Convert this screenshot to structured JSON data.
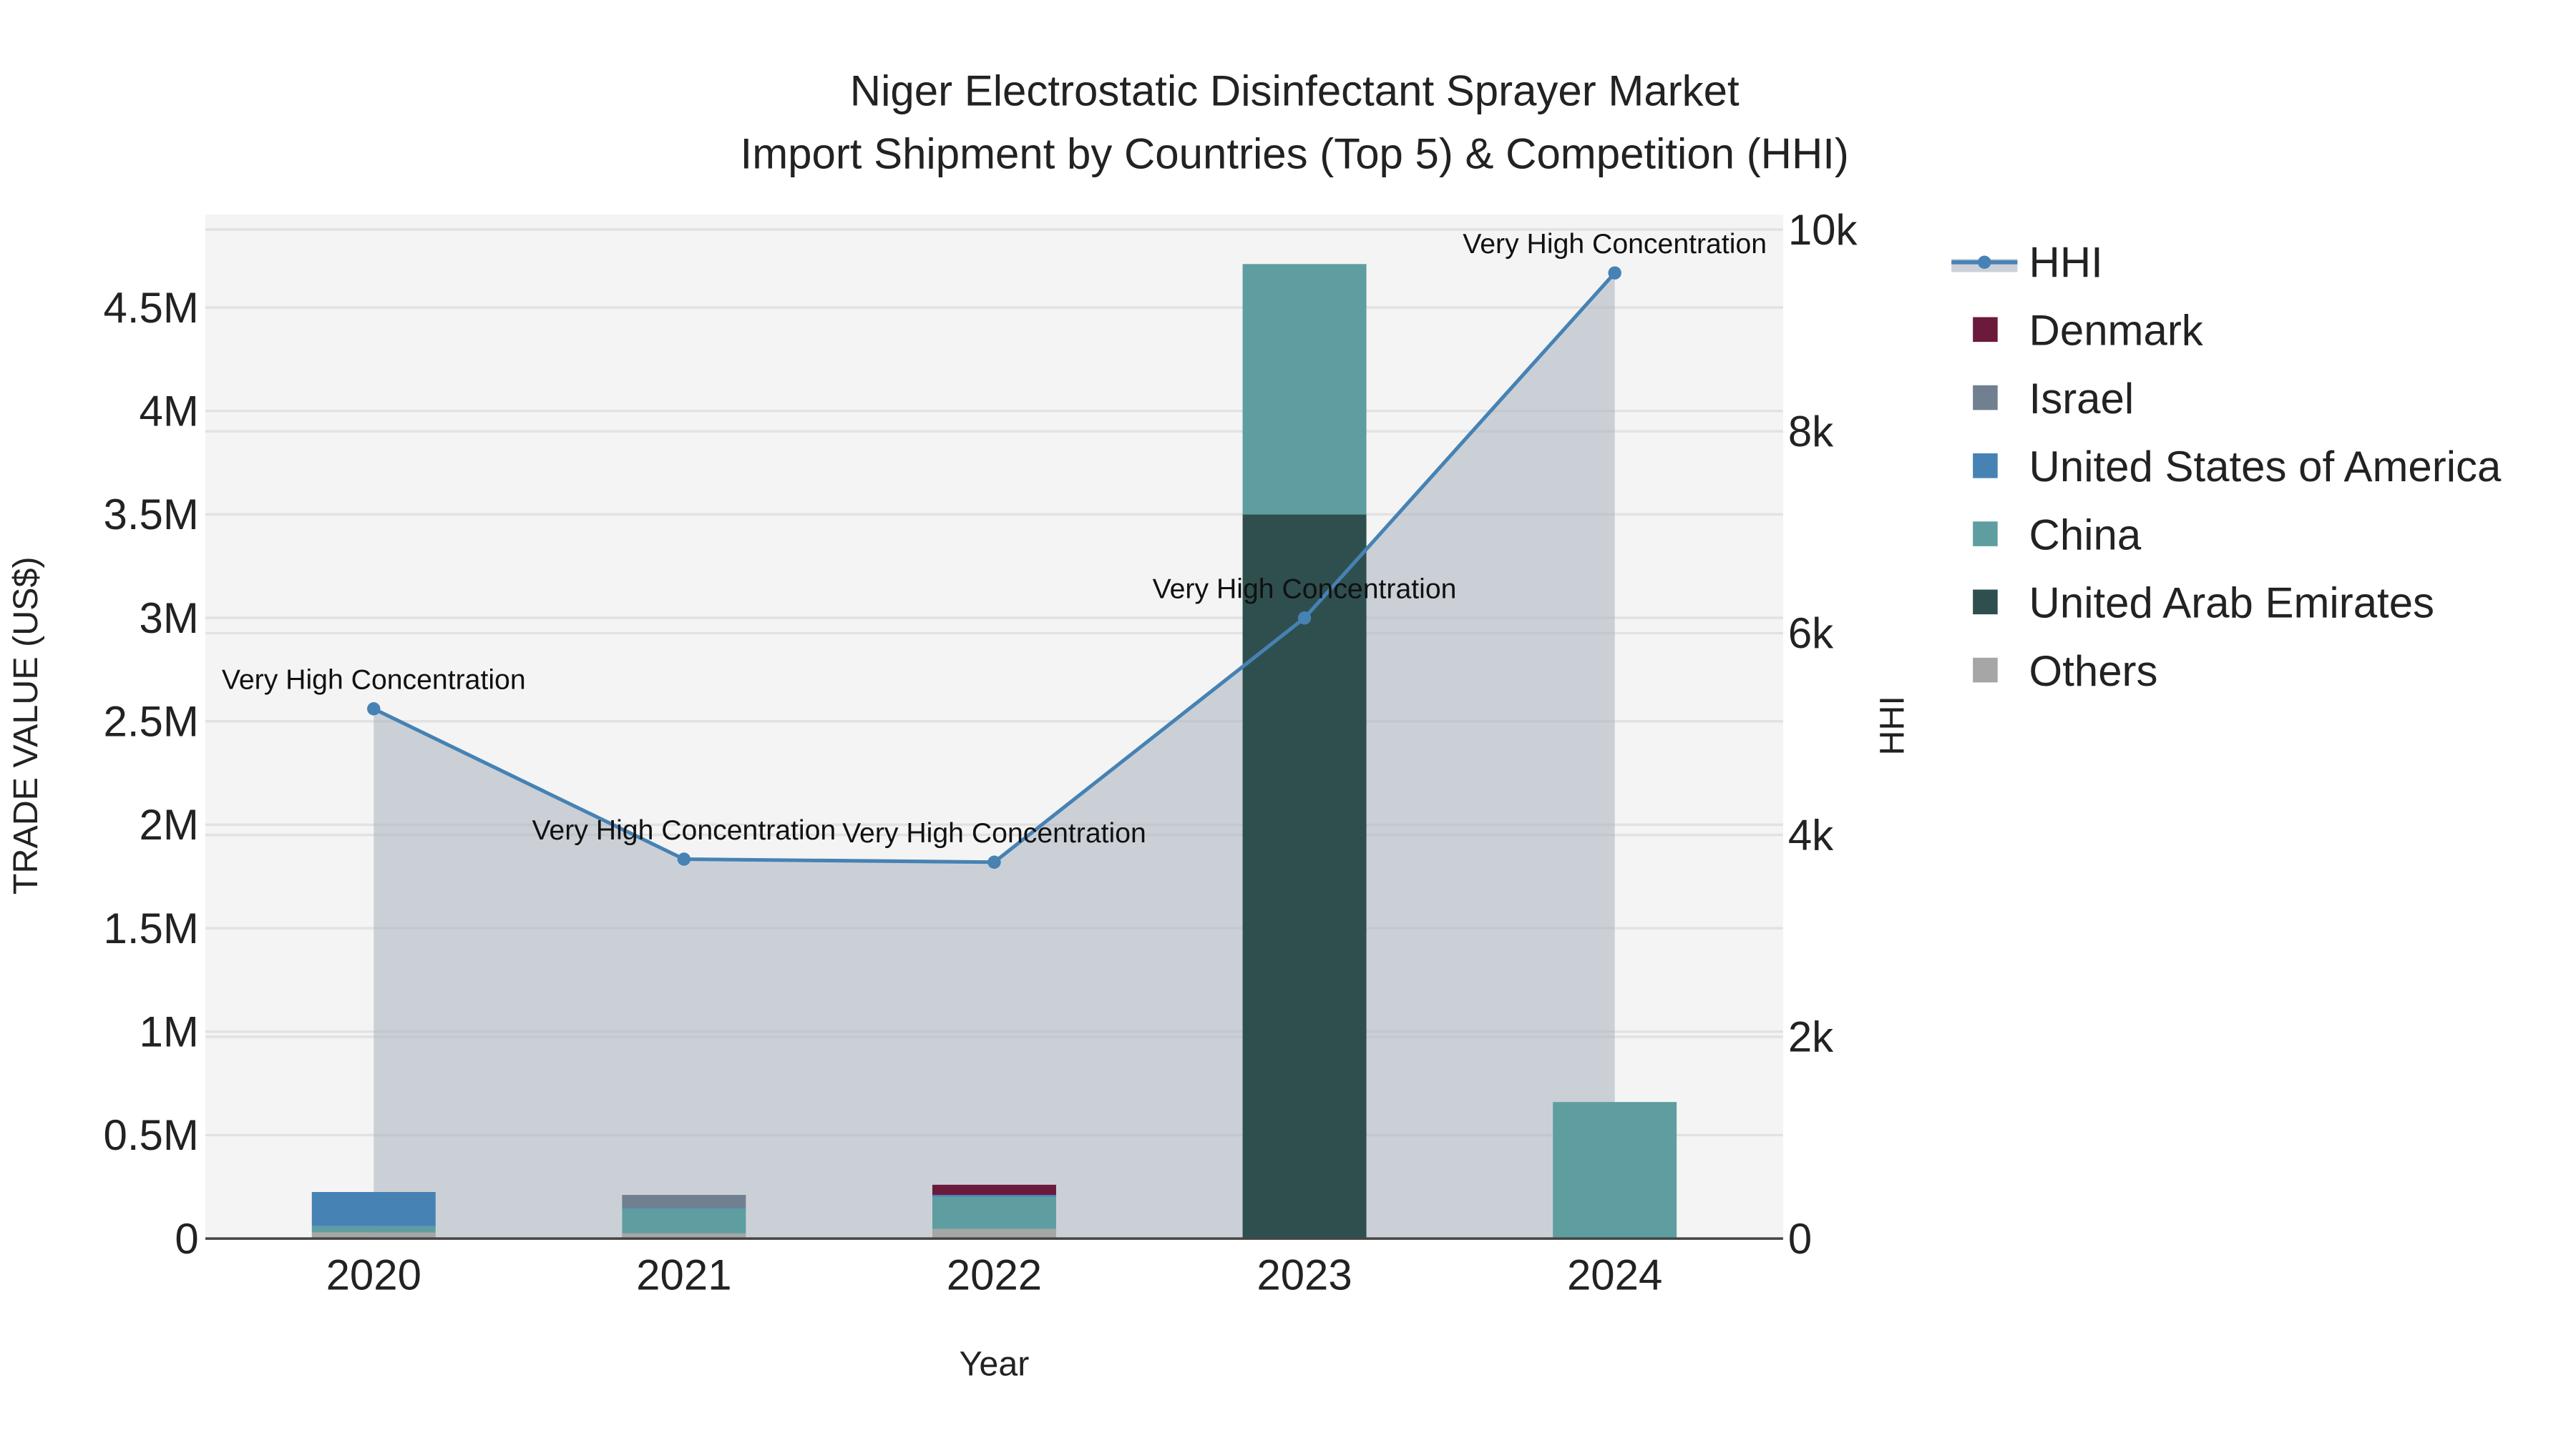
{
  "chart_data": {
    "type": "bar",
    "title_line1": "Niger Electrostatic Disinfectant Sprayer Market",
    "title_line2": "Import Shipment by Countries (Top 5) & Competition (HHI)",
    "xlabel": "Year",
    "ylabel": "TRADE VALUE (US$)",
    "y2label": "HHI",
    "categories": [
      "2020",
      "2021",
      "2022",
      "2023",
      "2024"
    ],
    "ylim": [
      0,
      4950000
    ],
    "y2lim": [
      0,
      10150
    ],
    "yticks": [
      {
        "value": 0,
        "label": "0"
      },
      {
        "value": 500000,
        "label": "0.5M"
      },
      {
        "value": 1000000,
        "label": "1M"
      },
      {
        "value": 1500000,
        "label": "1.5M"
      },
      {
        "value": 2000000,
        "label": "2M"
      },
      {
        "value": 2500000,
        "label": "2.5M"
      },
      {
        "value": 3000000,
        "label": "3M"
      },
      {
        "value": 3500000,
        "label": "3.5M"
      },
      {
        "value": 4000000,
        "label": "4M"
      },
      {
        "value": 4500000,
        "label": "4.5M"
      }
    ],
    "y2ticks": [
      {
        "value": 0,
        "label": "0"
      },
      {
        "value": 2000,
        "label": "2k"
      },
      {
        "value": 4000,
        "label": "4k"
      },
      {
        "value": 6000,
        "label": "6k"
      },
      {
        "value": 8000,
        "label": "8k"
      },
      {
        "value": 10000,
        "label": "10k"
      }
    ],
    "stacked": true,
    "series": [
      {
        "name": "Others",
        "color": "#a6a6a6",
        "values": [
          29000,
          25000,
          46000,
          0,
          0
        ]
      },
      {
        "name": "United Arab Emirates",
        "color": "#2f4f4f",
        "values": [
          0,
          0,
          0,
          3500000,
          0
        ]
      },
      {
        "name": "China",
        "color": "#5f9ea0",
        "values": [
          31000,
          118000,
          156000,
          1210000,
          660000
        ]
      },
      {
        "name": "United States of America",
        "color": "#4682b4",
        "values": [
          165000,
          5000,
          9000,
          0,
          0
        ]
      },
      {
        "name": "Israel",
        "color": "#708090",
        "values": [
          0,
          63000,
          0,
          0,
          0
        ]
      },
      {
        "name": "Denmark",
        "color": "#6b1a3c",
        "values": [
          0,
          0,
          49000,
          0,
          0
        ]
      }
    ],
    "hhi": {
      "name": "HHI",
      "color": "#4682b4",
      "values": [
        5250,
        3760,
        3730,
        6150,
        9570
      ],
      "annotations": [
        "Very High Concentration",
        "Very High Concentration",
        "Very High Concentration",
        "Very High Concentration",
        "Very High Concentration"
      ]
    },
    "legend_order": [
      "HHI",
      "Denmark",
      "Israel",
      "United States of America",
      "China",
      "United Arab Emirates",
      "Others"
    ],
    "legend_placement": "right-top",
    "grid": true
  }
}
